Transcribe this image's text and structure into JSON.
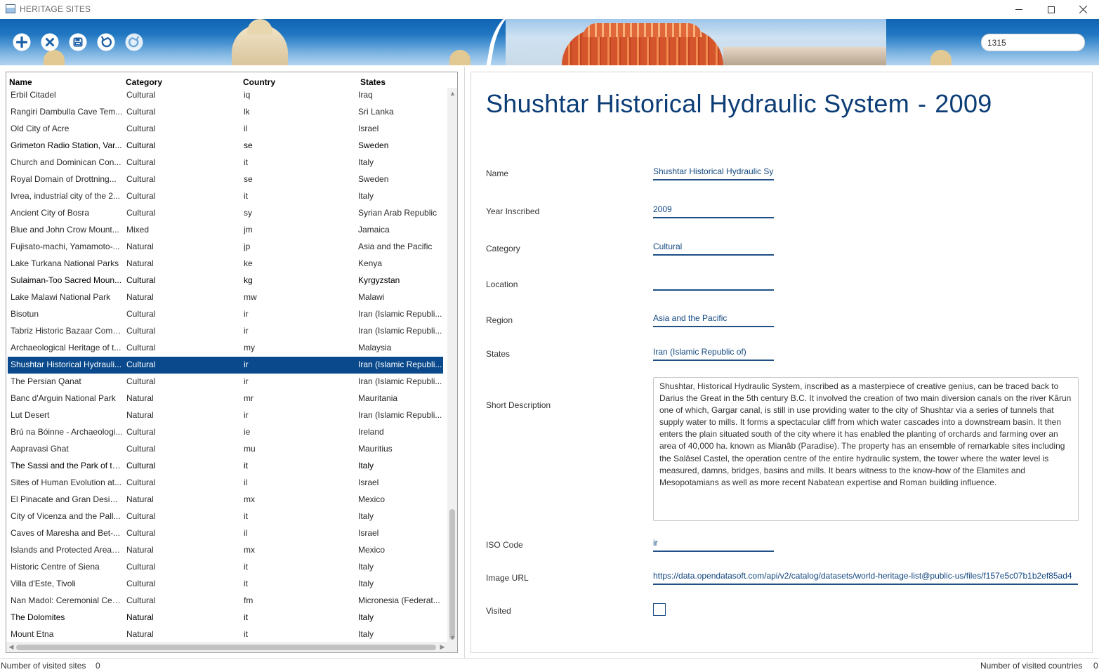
{
  "window": {
    "title": "HERITAGE SITES"
  },
  "toolbar": {
    "search_value": "1315",
    "buttons": [
      {
        "name": "add",
        "icon": "plus-circle-icon"
      },
      {
        "name": "delete",
        "icon": "close-circle-icon"
      },
      {
        "name": "save",
        "icon": "save-icon"
      },
      {
        "name": "undo",
        "icon": "undo-icon"
      },
      {
        "name": "redo",
        "icon": "redo-icon"
      }
    ]
  },
  "list": {
    "headers": {
      "name": "Name",
      "category": "Category",
      "country": "Country",
      "states": "States"
    },
    "rows": [
      {
        "name": "Erbil Citadel",
        "category": "Cultural",
        "country": "iq",
        "states": "Iraq"
      },
      {
        "name": "Rangiri Dambulla Cave Tem...",
        "category": "Cultural",
        "country": "lk",
        "states": "Sri Lanka"
      },
      {
        "name": "Old City of Acre",
        "category": "Cultural",
        "country": "il",
        "states": "Israel"
      },
      {
        "name": "Grimeton Radio Station, Var...",
        "category": "Cultural",
        "country": "se",
        "states": "Sweden",
        "bold": true
      },
      {
        "name": "Church and Dominican Con...",
        "category": "Cultural",
        "country": "it",
        "states": "Italy"
      },
      {
        "name": "Royal Domain of Drottning...",
        "category": "Cultural",
        "country": "se",
        "states": "Sweden"
      },
      {
        "name": "Ivrea, industrial city of the 2...",
        "category": "Cultural",
        "country": "it",
        "states": "Italy"
      },
      {
        "name": "Ancient City of Bosra",
        "category": "Cultural",
        "country": "sy",
        "states": "Syrian Arab Republic"
      },
      {
        "name": "Blue and John Crow Mount...",
        "category": "Mixed",
        "country": "jm",
        "states": "Jamaica"
      },
      {
        "name": " Fujisato-machi, Yamamoto-...",
        "category": "Natural",
        "country": "jp",
        "states": "Asia and the Pacific"
      },
      {
        "name": "Lake Turkana National Parks",
        "category": "Natural",
        "country": "ke",
        "states": "Kenya"
      },
      {
        "name": "Sulaiman-Too Sacred Moun...",
        "category": "Cultural",
        "country": "kg",
        "states": "Kyrgyzstan",
        "bold": true
      },
      {
        "name": "Lake Malawi National Park",
        "category": "Natural",
        "country": "mw",
        "states": "Malawi"
      },
      {
        "name": "Bisotun",
        "category": "Cultural",
        "country": "ir",
        "states": "Iran (Islamic Republi..."
      },
      {
        "name": "Tabriz Historic Bazaar Comp...",
        "category": "Cultural",
        "country": "ir",
        "states": "Iran (Islamic Republi..."
      },
      {
        "name": "Archaeological Heritage of t...",
        "category": "Cultural",
        "country": "my",
        "states": "Malaysia"
      },
      {
        "name": "Shushtar Historical Hydrauli...",
        "category": "Cultural",
        "country": "ir",
        "states": "Iran (Islamic Republi...",
        "selected": true
      },
      {
        "name": "The Persian Qanat",
        "category": "Cultural",
        "country": "ir",
        "states": "Iran (Islamic Republi..."
      },
      {
        "name": "Banc d'Arguin National Park",
        "category": "Natural",
        "country": "mr",
        "states": "Mauritania"
      },
      {
        "name": "Lut Desert",
        "category": "Natural",
        "country": "ir",
        "states": "Iran (Islamic Republi..."
      },
      {
        "name": "Brú na Bóinne - Archaeologi...",
        "category": "Cultural",
        "country": "ie",
        "states": "Ireland"
      },
      {
        "name": "Aapravasi Ghat",
        "category": "Cultural",
        "country": "mu",
        "states": "Mauritius"
      },
      {
        "name": "The Sassi and the Park of th...",
        "category": "Cultural",
        "country": "it",
        "states": "Italy",
        "bold": true
      },
      {
        "name": "Sites of Human Evolution at...",
        "category": "Cultural",
        "country": "il",
        "states": "Israel"
      },
      {
        "name": "El Pinacate and Gran Desiert...",
        "category": "Natural",
        "country": "mx",
        "states": "Mexico"
      },
      {
        "name": "City of Vicenza and the Pall...",
        "category": "Cultural",
        "country": "it",
        "states": "Italy"
      },
      {
        "name": "Caves of Maresha and Bet-...",
        "category": "Cultural",
        "country": "il",
        "states": "Israel"
      },
      {
        "name": "Islands and Protected Areas...",
        "category": "Natural",
        "country": "mx",
        "states": "Mexico"
      },
      {
        "name": "Historic Centre of Siena",
        "category": "Cultural",
        "country": "it",
        "states": "Italy"
      },
      {
        "name": "Villa d'Este, Tivoli",
        "category": "Cultural",
        "country": "it",
        "states": "Italy"
      },
      {
        "name": "Nan Madol: Ceremonial Cen...",
        "category": "Cultural",
        "country": "fm",
        "states": "Micronesia (Federat..."
      },
      {
        "name": "The Dolomites",
        "category": "Natural",
        "country": "it",
        "states": "Italy",
        "bold": true
      },
      {
        "name": "Mount Etna",
        "category": "Natural",
        "country": "it",
        "states": "Italy"
      }
    ]
  },
  "detail": {
    "title_name": "Shushtar Historical Hydraulic System",
    "title_separator": "-",
    "title_year": "2009",
    "labels": {
      "name": "Name",
      "year": "Year Inscribed",
      "category": "Category",
      "location": "Location",
      "region": "Region",
      "states": "States",
      "short_description": "Short Description",
      "iso_code": "ISO Code",
      "image_url": "Image URL",
      "visited": "Visited"
    },
    "values": {
      "name": "Shushtar Historical Hydraulic System",
      "year": "2009",
      "category": "Cultural",
      "location": "",
      "region": "Asia and the Pacific",
      "states": "Iran (Islamic Republic of)",
      "short_description": "Shushtar, Historical Hydraulic System, inscribed as a masterpiece of creative genius, can be traced back to Darius the Great in the 5th century B.C. It involved the creation of two main diversion canals on the river Kârun one of which, Gargar canal, is still in use providing water to the city of Shushtar via a series of tunnels that supply water to mills. It forms a spectacular cliff from which water cascades into a downstream basin. It then enters the plain situated south of the city where it has enabled the planting of orchards and farming over an area of 40,000 ha. known as Mianâb (Paradise). The property has an ensemble of remarkable sites including the Salâsel Castel, the operation centre of the entire hydraulic system, the tower where the water level is measured, damns, bridges, basins and mills. It bears witness to the know-how of the Elamites and Mesopotamians as well as more recent Nabatean expertise and Roman building influence.",
      "iso_code": "ir",
      "image_url": "https://data.opendatasoft.com/api/v2/catalog/datasets/world-heritage-list@public-us/files/f157e5c07b1b2ef85ad4",
      "visited": false
    }
  },
  "status": {
    "visited_sites_label": "Number of visited sites",
    "visited_sites_value": "0",
    "visited_countries_label": "Number of visited countries",
    "visited_countries_value": "0"
  },
  "colors": {
    "selection": "#0a4a8c",
    "accent": "#0c3d76",
    "banner": "#2d83cb"
  }
}
